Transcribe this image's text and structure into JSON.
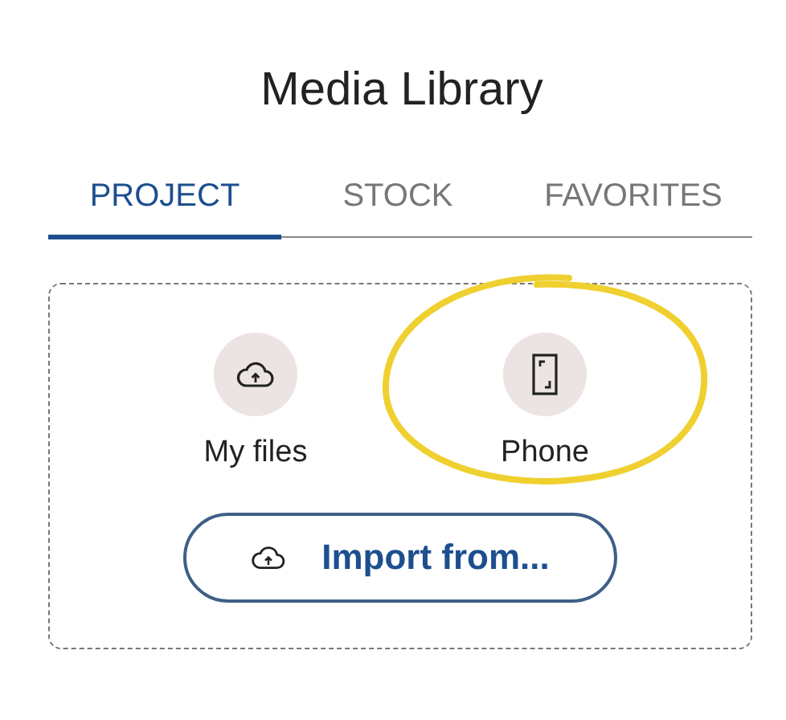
{
  "title": "Media Library",
  "tabs": [
    {
      "label": "PROJECT",
      "selected": true
    },
    {
      "label": "STOCK",
      "selected": false
    },
    {
      "label": "FAVORITES",
      "selected": false
    }
  ],
  "sources": [
    {
      "kind": "cloud",
      "label": "My files",
      "highlighted": false
    },
    {
      "kind": "phone",
      "label": "Phone",
      "highlighted": true
    }
  ],
  "import_button": "Import from..."
}
